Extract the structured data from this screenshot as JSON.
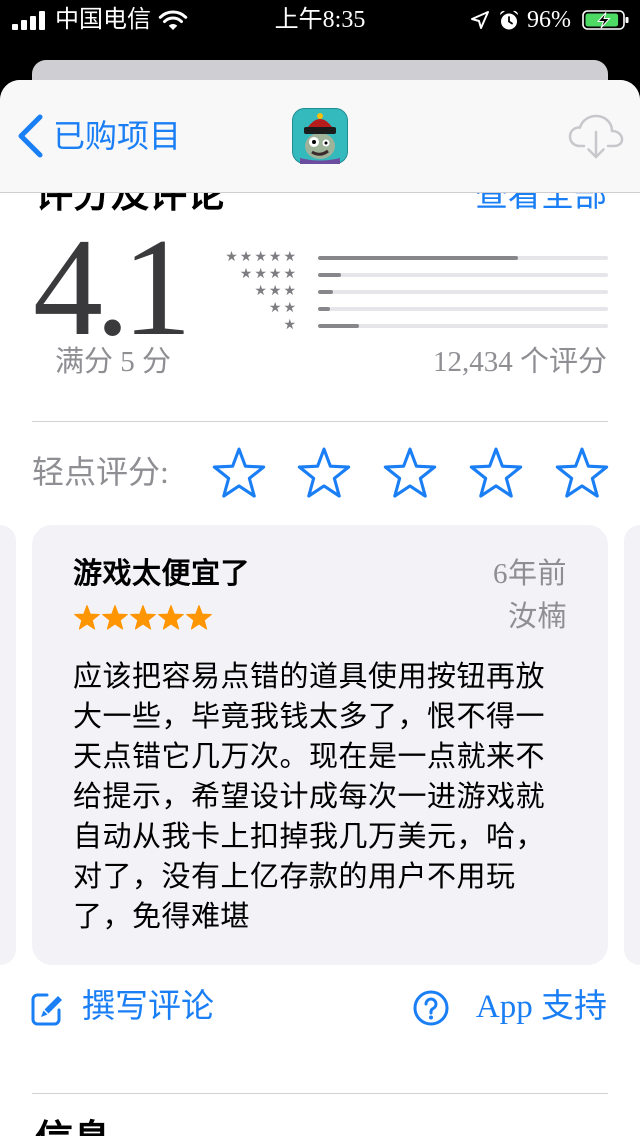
{
  "status_bar": {
    "carrier": "中国电信",
    "time": "上午8:35",
    "battery": "96%",
    "battery_level": 0.96
  },
  "nav": {
    "back_label": "已购项目"
  },
  "ratings": {
    "heading": "评分及评论",
    "see_all": "查看全部",
    "average": "4.1",
    "out_of": "满分 5 分",
    "count": "12,434 个评分",
    "distribution": [
      {
        "stars": 5,
        "fraction": 0.69
      },
      {
        "stars": 4,
        "fraction": 0.08
      },
      {
        "stars": 3,
        "fraction": 0.05
      },
      {
        "stars": 2,
        "fraction": 0.04
      },
      {
        "stars": 1,
        "fraction": 0.14
      }
    ]
  },
  "tap_to_rate": {
    "label": "轻点评分:"
  },
  "review": {
    "title": "游戏太便宜了",
    "age": "6年前",
    "author": "汝楠",
    "rating": 5,
    "body_lines": [
      "应该把容易点错的道具使用按钮再放",
      "大一些，毕竟我钱太多了，恨不得一",
      "天点错它几万次。现在是一点就来不",
      "给提示，希望设计成每次一进游戏就",
      "自动从我卡上扣掉我几万美元，哈，",
      "对了，没有上亿存款的用户不用玩",
      "了，免得难堪"
    ]
  },
  "actions": {
    "write_review": "撰写评论",
    "app_support": "App 支持"
  },
  "info": {
    "heading": "信息"
  },
  "colors": {
    "accent": "#1a7ef5",
    "rating_star": "#ff9500",
    "secondary_text": "#8e8e93",
    "battery_charging": "#4cd964",
    "card_background": "#f2f2f7"
  }
}
